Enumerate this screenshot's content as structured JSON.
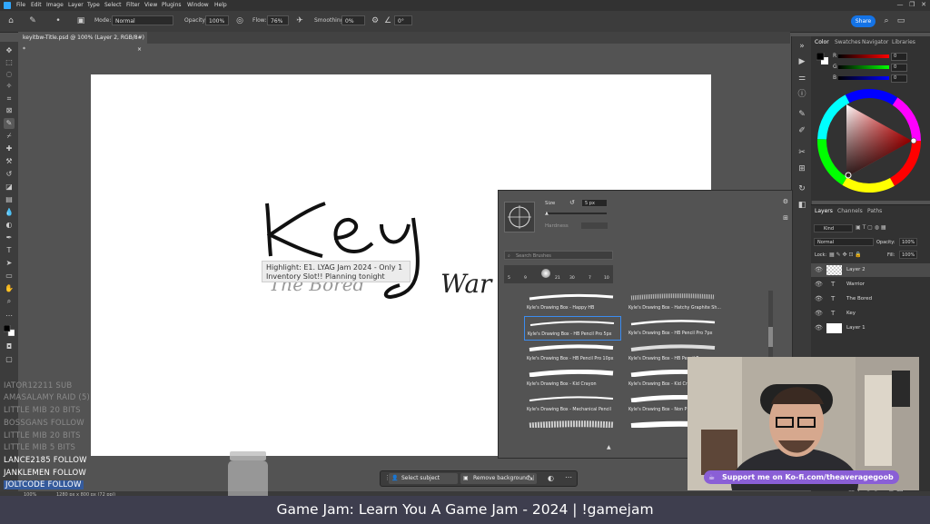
{
  "menu": {
    "items": [
      "File",
      "Edit",
      "Image",
      "Layer",
      "Type",
      "Select",
      "Filter",
      "View",
      "Plugins",
      "Window",
      "Help"
    ]
  },
  "options_bar": {
    "mode_label": "Mode:",
    "mode_value": "Normal",
    "opacity_label": "Opacity:",
    "opacity_value": "100%",
    "flow_label": "Flow:",
    "flow_value": "76%",
    "smoothing_label": "Smoothing:",
    "smoothing_value": "0%",
    "angle_value": "0°",
    "share_label": "Share"
  },
  "document_tab": {
    "title": "keyitbw-Title.psd @ 100% (Layer 2, RGB/8#) *",
    "close": "×"
  },
  "canvas": {
    "key_text": "Key",
    "bored_text": "The Bored",
    "warrior_text": "War"
  },
  "highlight": {
    "line1": "Highlight: E1. LYAG Jam 2024 - Only 1",
    "line2": "Inventory Slot!! Planning tonight"
  },
  "color_panel": {
    "tabs": [
      "Color",
      "Swatches",
      "Navigator",
      "Libraries"
    ],
    "rgb_labels": [
      "R",
      "G",
      "B"
    ],
    "rgb_values": [
      "0",
      "0",
      "0"
    ],
    "accent_hue": "#ff0000"
  },
  "layers_panel": {
    "tabs": [
      "Layers",
      "Channels",
      "Paths"
    ],
    "kind_label": "Kind",
    "blend_mode": "Normal",
    "opacity_label": "Opacity:",
    "opacity_value": "100%",
    "lock_label": "Lock:",
    "fill_label": "Fill:",
    "fill_value": "100%",
    "layers": [
      {
        "name": "Layer 2",
        "type": "pixel-transparent"
      },
      {
        "name": "Warrior",
        "type": "text"
      },
      {
        "name": "The Bored",
        "type": "text"
      },
      {
        "name": "Key",
        "type": "text"
      },
      {
        "name": "Layer 1",
        "type": "pixel-white"
      }
    ]
  },
  "brush_panel": {
    "size_label": "Size",
    "size_value": "5 px",
    "hardness_label": "Hardness",
    "search_placeholder": "Search Brushes",
    "preset_numbers": [
      "5",
      "9",
      "13",
      "21",
      "30",
      "7",
      "10"
    ],
    "brushes": [
      {
        "name": "Kyle's Drawing Box - Happy HB",
        "selected": false
      },
      {
        "name": "Kyle's Drawing Box - Hatchy Graphite Sh...",
        "selected": false
      },
      {
        "name": "Kyle's Drawing Box - HB Pencil Pro 5px",
        "selected": true
      },
      {
        "name": "Kyle's Drawing Box - HB Pencil Pro 7px",
        "selected": false
      },
      {
        "name": "Kyle's Drawing Box - HB Pencil Pro 10px",
        "selected": false
      },
      {
        "name": "Kyle's Drawing Box - HB Pencil Pro",
        "selected": false
      },
      {
        "name": "Kyle's Drawing Box - Kid Crayon",
        "selected": false
      },
      {
        "name": "Kyle's Drawing Box - Kid Cr",
        "selected": false
      },
      {
        "name": "Kyle's Drawing Box - Mechanical Pencil",
        "selected": false
      },
      {
        "name": "Kyle's Drawing Box - Non P",
        "selected": false
      }
    ]
  },
  "chat": {
    "lines": [
      {
        "text": "IATOR12211  SUB",
        "faded": true
      },
      {
        "text": "AMASALAMY  RAID (5)",
        "faded": true
      },
      {
        "text": "LITTLE MIB  20 BITS",
        "faded": true
      },
      {
        "text": "BOSSGANS  FOLLOW",
        "faded": true
      },
      {
        "text": "LITTLE MIB  20 BITS",
        "faded": true
      },
      {
        "text": "LITTLE MIB  5 BITS",
        "faded": true
      },
      {
        "text": "LANCE2185  FOLLOW",
        "faded": false
      },
      {
        "text": "JANKLEMEN  FOLLOW",
        "faded": false
      },
      {
        "text": "JOLTCODE  FOLLOW",
        "faded": false,
        "highlighted": true
      }
    ]
  },
  "context_bar": {
    "select_subject": "Select subject",
    "remove_background": "Remove background"
  },
  "status_bar": {
    "zoom": "100%",
    "doc_info": "1280 px x 800 px (72 ppi)"
  },
  "kofi": {
    "text": "Support me on Ko-fi.com/theaveragegoob"
  },
  "banner": {
    "text": "Game Jam: Learn You A Game Jam - 2024 | !gamejam"
  }
}
